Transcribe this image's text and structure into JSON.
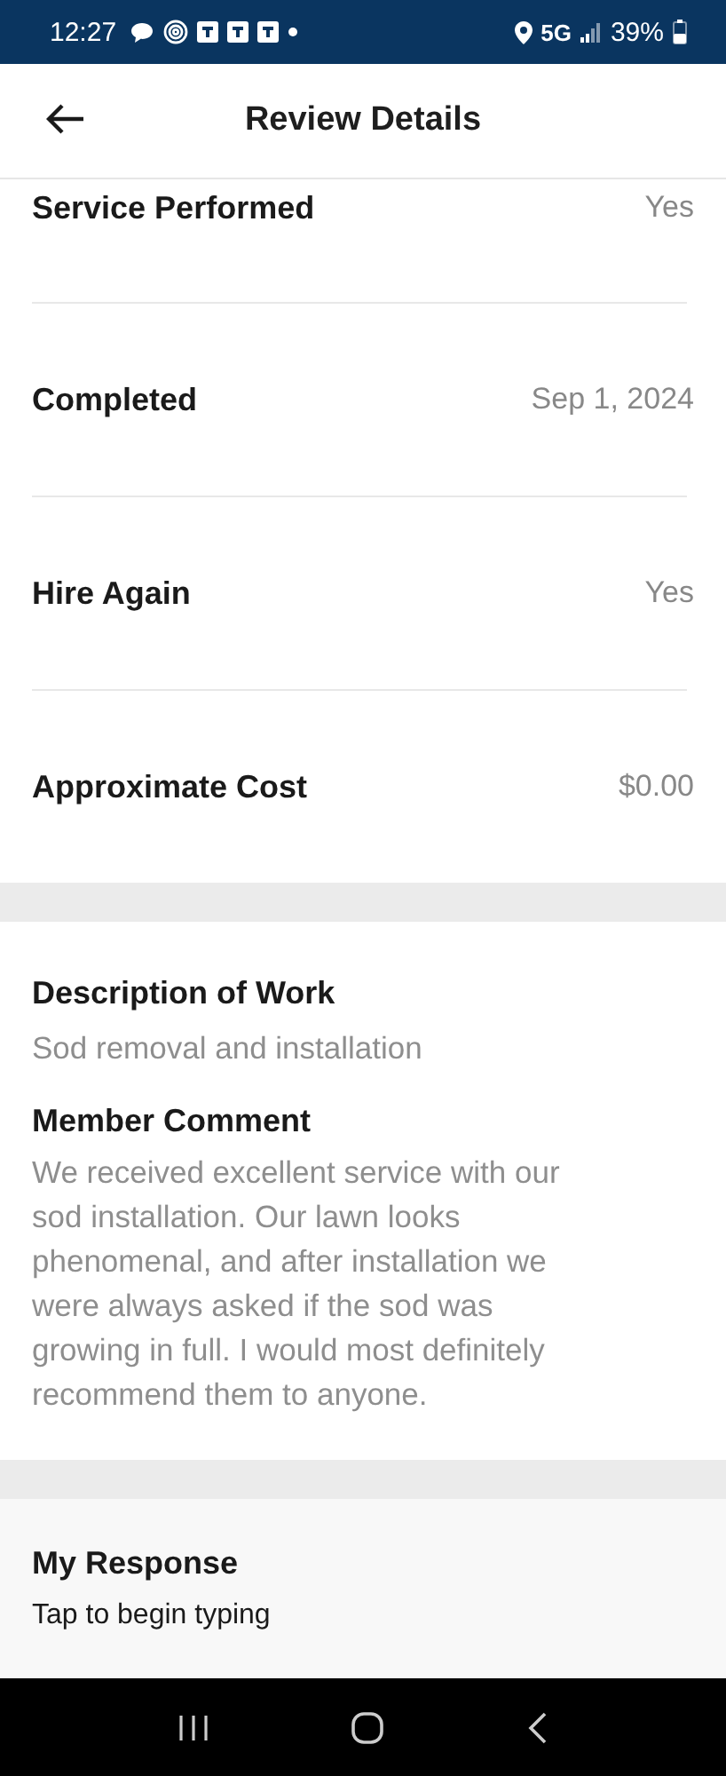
{
  "status_bar": {
    "time": "12:27",
    "network": "5G",
    "battery": "39%"
  },
  "header": {
    "title": "Review Details"
  },
  "details": [
    {
      "label": "Service Performed",
      "value": "Yes"
    },
    {
      "label": "Completed",
      "value": "Sep 1, 2024"
    },
    {
      "label": "Hire Again",
      "value": "Yes"
    },
    {
      "label": "Approximate Cost",
      "value": "$0.00"
    }
  ],
  "description": {
    "heading": "Description of Work",
    "text": "Sod removal and installation"
  },
  "comment": {
    "heading": "Member Comment",
    "text": "We received excellent service with our sod installation. Our lawn looks phenomenal, and after installation we were always asked if the sod was growing in full. I would most definitely recommend them to anyone."
  },
  "response": {
    "heading": "My Response",
    "placeholder": "Tap to begin typing"
  }
}
